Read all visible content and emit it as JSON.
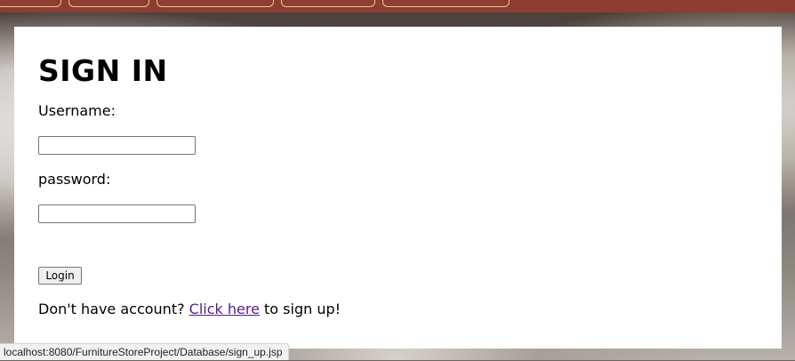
{
  "nav": {
    "tabs": [
      {
        "label": ""
      },
      {
        "label": ""
      },
      {
        "label": ""
      },
      {
        "label": ""
      },
      {
        "label": ""
      }
    ]
  },
  "form": {
    "title": "SIGN IN",
    "username_label": "Username:",
    "username_value": "",
    "password_label": "password:",
    "password_value": "",
    "login_button": "Login",
    "signup_prefix": "Don't have account? ",
    "signup_link": "Click here",
    "signup_suffix": " to sign up!"
  },
  "status": {
    "url": "localhost:8080/FurnitureStoreProject/Database/sign_up.jsp"
  },
  "colors": {
    "nav_bar": "#8d3e2f",
    "link_visited": "#551a8b"
  }
}
